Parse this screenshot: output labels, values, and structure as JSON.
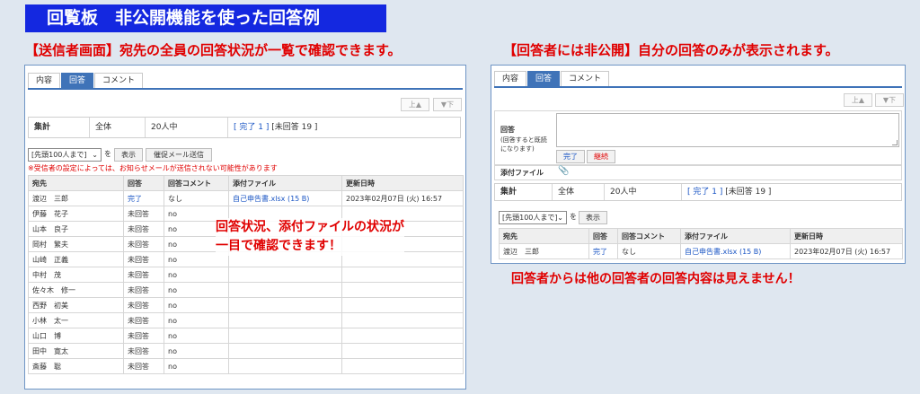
{
  "banner": "回覧板　非公開機能を使った回答例",
  "left_caption": "【送信者画面】宛先の全員の回答状況が一覧で確認できます。",
  "right_caption": "【回答者には非公開】自分の回答のみが表示されます。",
  "tabs": {
    "content": "内容",
    "answer": "回答",
    "comment": "コメント"
  },
  "nav": {
    "up": "上▲",
    "down": "▼下"
  },
  "tally": {
    "label": "集計",
    "scope": "全体",
    "total": "20人中",
    "done": "[ 完了  1 ]",
    "pending": "[未回答 19 ]"
  },
  "list_control": {
    "select": "[先頭100人まで]",
    "wo": "を",
    "show": "表示",
    "remind": "催促メール送信"
  },
  "note": "※受信者の設定によっては、お知らせメールが送信されない可能性があります",
  "columns": [
    "宛先",
    "回答",
    "回答コメント",
    "添付ファイル",
    "更新日時"
  ],
  "rows": [
    [
      "渡辺　三郎",
      "完了",
      "なし",
      "自己申告書.xlsx (15 B)",
      "2023年02月07日 (火) 16:57"
    ],
    [
      "伊藤　花子",
      "未回答",
      "no",
      "",
      ""
    ],
    [
      "山本　良子",
      "未回答",
      "no",
      "",
      ""
    ],
    [
      "岡村　繁夫",
      "未回答",
      "no",
      "",
      ""
    ],
    [
      "山崎　正義",
      "未回答",
      "no",
      "",
      ""
    ],
    [
      "中村　茂",
      "未回答",
      "no",
      "",
      ""
    ],
    [
      "佐々木　修一",
      "未回答",
      "no",
      "",
      ""
    ],
    [
      "西野　初美",
      "未回答",
      "no",
      "",
      ""
    ],
    [
      "小林　太一",
      "未回答",
      "no",
      "",
      ""
    ],
    [
      "山口　博",
      "未回答",
      "no",
      "",
      ""
    ],
    [
      "田中　寛太",
      "未回答",
      "no",
      "",
      ""
    ],
    [
      "斎藤　聡",
      "未回答",
      "no",
      "",
      ""
    ]
  ],
  "overlay_left": [
    "回答状況、添付ファイルの状況が",
    "一目で確認できます！"
  ],
  "answer_form": {
    "label": "回答",
    "hint": "(回答すると既読になります)",
    "done_btn": "完了",
    "continue_btn": "継続",
    "attach_label": "添付ファイル",
    "attach_icon": "paperclip-icon"
  },
  "right_row": [
    "渡辺　三郎",
    "完了",
    "なし",
    "自己申告書.xlsx (15 B)",
    "2023年02月07日 (火) 16:57"
  ],
  "bottom_caption": "回答者からは他の回答者の回答内容は見えません！",
  "colors": {
    "banner": "#1428e0",
    "accent": "#3f73b8",
    "alert": "#e00000",
    "link": "#1a55c4"
  }
}
